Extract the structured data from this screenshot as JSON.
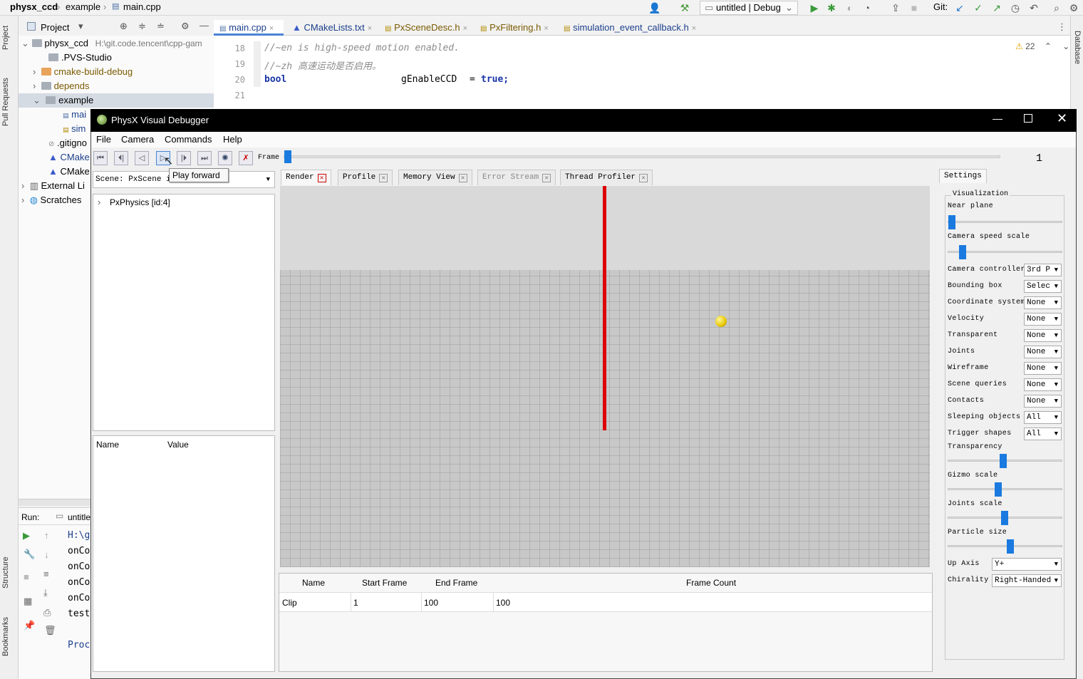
{
  "ide": {
    "breadcrumb": [
      "physx_ccd",
      "example",
      "main.cpp"
    ],
    "run_config": "untitled | Debug",
    "git_label": "Git:",
    "left_tabs": [
      "Project",
      "Pull Requests",
      "Structure",
      "Bookmarks"
    ],
    "right_tabs": [
      "Database"
    ],
    "project_panel": {
      "title": "Project",
      "tree": [
        {
          "label": "physx_ccd",
          "extra": "H:\\git.code.tencent\\cpp-gam",
          "depth": 0
        },
        {
          "label": ".PVS-Studio",
          "depth": 1
        },
        {
          "label": "cmake-build-debug",
          "depth": 1
        },
        {
          "label": "depends",
          "depth": 1
        },
        {
          "label": "example",
          "depth": 1
        },
        {
          "label": "mai",
          "depth": 2
        },
        {
          "label": "sim",
          "depth": 2
        },
        {
          "label": ".gitigno",
          "depth": 1
        },
        {
          "label": "CMake",
          "depth": 1
        },
        {
          "label": "CMake",
          "depth": 1
        },
        {
          "label": "External Li",
          "depth": 0
        },
        {
          "label": "Scratches",
          "depth": 0
        }
      ]
    },
    "editor_tabs": [
      "main.cpp",
      "CMakeLists.txt",
      "PxSceneDesc.h",
      "PxFiltering.h",
      "simulation_event_callback.h"
    ],
    "warnings_count": "22",
    "code_lines": [
      {
        "num": "18",
        "text": "//~en is high-speed motion enabled."
      },
      {
        "num": "19",
        "text": "//~zh 高速运动是否启用。"
      },
      {
        "num": "20",
        "text_kw": "bool",
        "text_var": "gEnableCCD",
        "text_op": "=",
        "text_val": "true;"
      },
      {
        "num": "21",
        "text": ""
      }
    ],
    "run_panel": {
      "label": "Run:",
      "tab": "untitle",
      "lines": [
        "H:\\g",
        "onCo",
        "onCo",
        "onCo",
        "onCo",
        "test",
        "Proc"
      ]
    }
  },
  "pvd": {
    "title": "PhysX Visual Debugger",
    "menu": [
      "File",
      "Camera",
      "Commands",
      "Help"
    ],
    "frame_label": "Frame",
    "frame_value": "1",
    "frame_progress": 0,
    "tooltip": "Play forward",
    "scene_select": "Scene: PxScene id",
    "scene_tree_root": "PxPhysics [id:4]",
    "props_headers": [
      "Name",
      "Value"
    ],
    "tabs": [
      "Render",
      "Profile",
      "Memory View",
      "Error Stream",
      "Thread Profiler"
    ],
    "clip_table": {
      "headers": [
        "Name",
        "Start Frame",
        "End Frame",
        "Frame Count"
      ],
      "rows": [
        [
          "Clip",
          "1",
          "100",
          "100"
        ]
      ]
    },
    "settings": {
      "tab": "Settings",
      "group": "Visualization",
      "near_plane_label": "Near plane",
      "near_plane": 0.0,
      "camera_speed_label": "Camera speed scale",
      "camera_speed": 0.1,
      "selects": [
        {
          "label": "Camera controller",
          "value": "3rd P"
        },
        {
          "label": "Bounding box",
          "value": "Selec"
        },
        {
          "label": "Coordinate system",
          "value": "None"
        },
        {
          "label": "Velocity",
          "value": "None"
        },
        {
          "label": "Transparent",
          "value": "None"
        },
        {
          "label": "Joints",
          "value": "None"
        },
        {
          "label": "Wireframe",
          "value": "None"
        },
        {
          "label": "Scene queries",
          "value": "None"
        },
        {
          "label": "Contacts",
          "value": "None"
        },
        {
          "label": "Sleeping objects",
          "value": "All"
        },
        {
          "label": "Trigger shapes",
          "value": "All"
        }
      ],
      "sliders": [
        {
          "label": "Transparency",
          "value": 0.48
        },
        {
          "label": "Gizmo scale",
          "value": 0.43
        },
        {
          "label": "Joints scale",
          "value": 0.49
        },
        {
          "label": "Particle size",
          "value": 0.54
        }
      ],
      "up_axis_label": "Up Axis",
      "up_axis": "Y+",
      "chirality_label": "Chirality",
      "chirality": "Right-Handed"
    }
  },
  "colors": {
    "accent": "#1a7ae0",
    "red_line": "#dd0000",
    "ball": "#f0d000"
  }
}
